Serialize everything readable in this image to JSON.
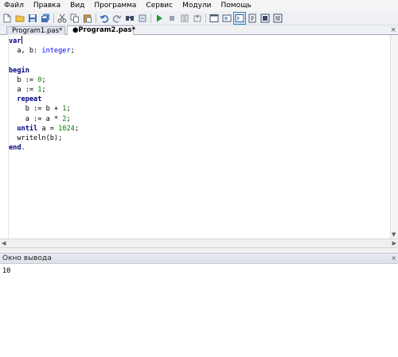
{
  "menu": [
    "Файл",
    "Правка",
    "Вид",
    "Программа",
    "Сервис",
    "Модули",
    "Помощь"
  ],
  "toolbar": {
    "icons": [
      "new-file-icon",
      "open-folder-icon",
      "save-icon",
      "save-all-icon",
      "cut-icon",
      "copy-icon",
      "paste-icon",
      "undo-icon",
      "redo-icon",
      "find-icon",
      "debug-icon",
      "run-icon",
      "pause-icon",
      "stop-icon",
      "step-icon",
      "output-window-icon",
      "form-icon",
      "module-icon",
      "compile-icon"
    ]
  },
  "tabs": [
    {
      "label": "Program1.pas*"
    },
    {
      "label": "●Program2.pas*"
    }
  ],
  "tab_close": "×",
  "editor": {
    "lines": [
      "var",
      "  a, b: integer;",
      "",
      "begin",
      "  b := 0;",
      "  a := 1;",
      "  repeat",
      "    b := b + 1;",
      "    a := a * 2;",
      "  until a = 1024;",
      "  writeln(b);",
      "end."
    ]
  },
  "output": {
    "title": "Окно вывода",
    "close": "×",
    "text": "10"
  },
  "colors": {
    "keyword": "#000080",
    "type": "#0000ff",
    "number": "#008000"
  }
}
